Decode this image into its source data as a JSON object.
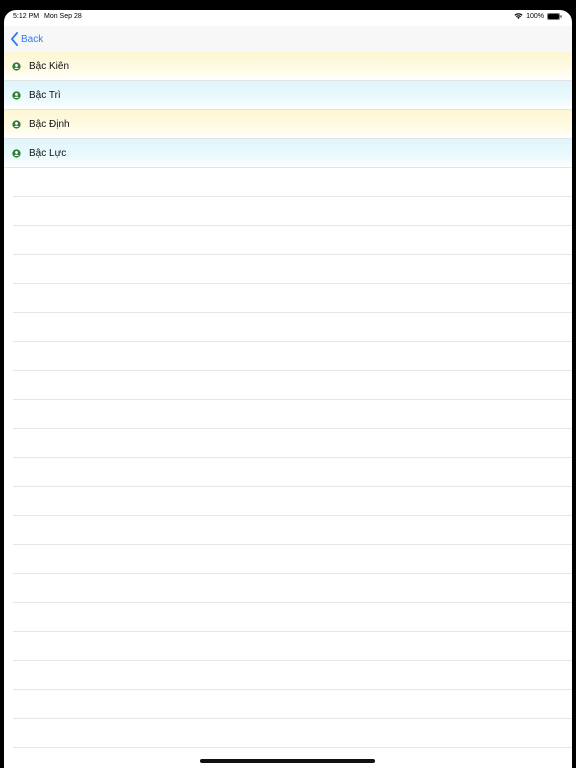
{
  "status_bar": {
    "time": "5:12 PM",
    "date": "Mon Sep 28",
    "battery": "100%"
  },
  "nav": {
    "back_label": "Back"
  },
  "list": {
    "items": [
      {
        "label": "Bậc Kiên",
        "color": "#fdf6d2"
      },
      {
        "label": "Bậc Trì",
        "color": "#ddf5fb"
      },
      {
        "label": "Bậc Định",
        "color": "#fdf6d2"
      },
      {
        "label": "Bậc Lực",
        "color": "#ddf5fb"
      }
    ],
    "icon": "person-badge-icon",
    "icon_color": "#2e7d32"
  },
  "colors": {
    "accent": "#2f7bf5"
  }
}
